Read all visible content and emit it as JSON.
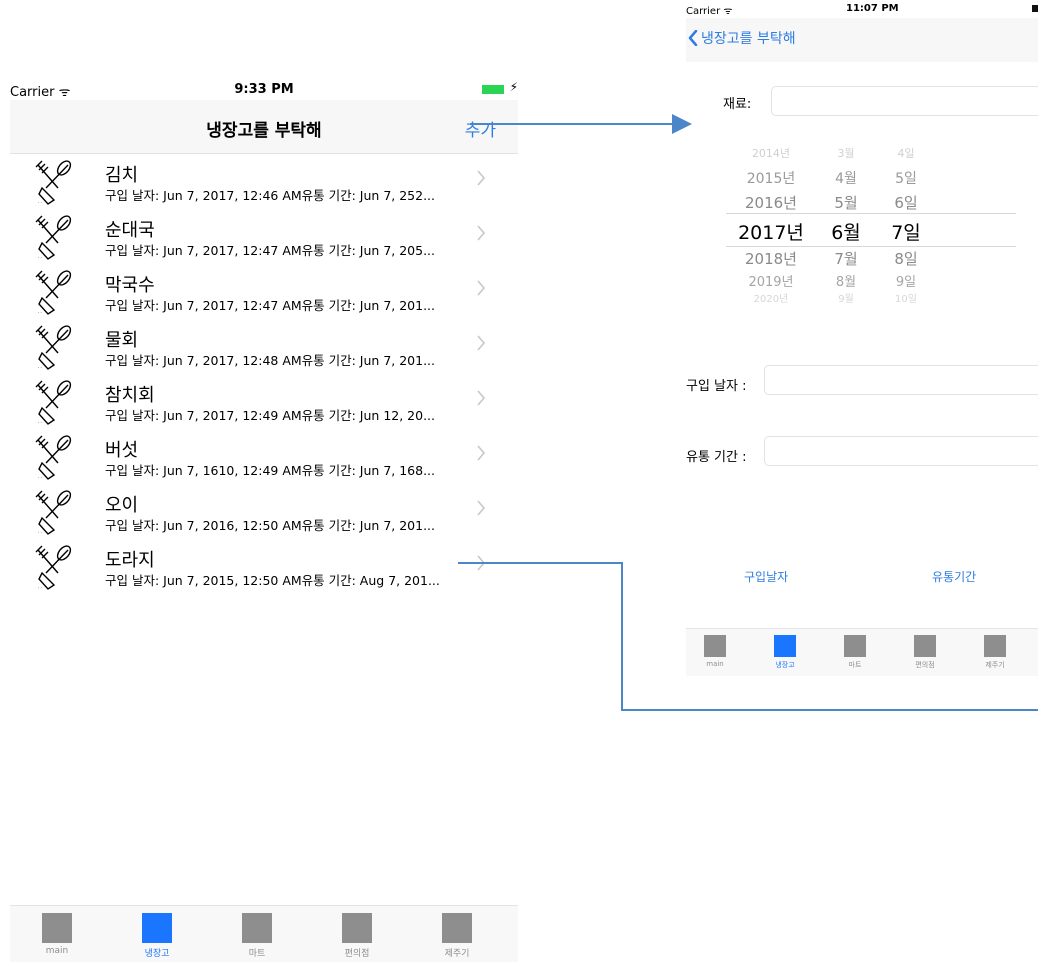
{
  "left_screen": {
    "status": {
      "carrier": "Carrier ᯤ",
      "time": "9:33 PM",
      "charge": "⚡"
    },
    "nav": {
      "title": "냉장고를 부탁해",
      "add_button": "추가"
    },
    "items": [
      {
        "name": "김치",
        "detail": "구입 날자: Jun 7, 2017, 12:46 AM유통 기간: Jun 7, 252..."
      },
      {
        "name": "순대국",
        "detail": "구입 날자: Jun 7, 2017, 12:47 AM유통 기간: Jun 7, 205..."
      },
      {
        "name": "막국수",
        "detail": "구입 날자: Jun 7, 2017, 12:47 AM유통 기간: Jun 7, 201..."
      },
      {
        "name": "물회",
        "detail": "구입 날자: Jun 7, 2017, 12:48 AM유통 기간: Jun 7, 201..."
      },
      {
        "name": "참치회",
        "detail": "구입 날자: Jun 7, 2017, 12:49 AM유통 기간: Jun 12, 20..."
      },
      {
        "name": "버섯",
        "detail": "구입 날자: Jun 7, 1610, 12:49 AM유통 기간: Jun 7, 168..."
      },
      {
        "name": "오이",
        "detail": "구입 날자: Jun 7, 2016, 12:50 AM유통 기간: Jun 7, 201..."
      },
      {
        "name": "도라지",
        "detail": "구입 날자: Jun 7, 2015, 12:50 AM유통 기간: Aug 7, 201..."
      }
    ],
    "tabs": [
      "main",
      "냉장고",
      "마트",
      "편의점",
      "제주기"
    ],
    "active_tab": 1
  },
  "right_screen": {
    "status": {
      "carrier": "Carrier ᯤ",
      "time": "11:07 PM"
    },
    "nav": {
      "back_label": "냉장고를 부탁해"
    },
    "ingredient_label": "재료:",
    "picker": {
      "years": [
        "2014년",
        "2015년",
        "2016년",
        "2017년",
        "2018년",
        "2019년",
        "2020년"
      ],
      "months": [
        "3월",
        "4월",
        "5월",
        "6월",
        "7월",
        "8월",
        "9월"
      ],
      "days": [
        "4일",
        "5일",
        "6일",
        "7일",
        "8일",
        "9일",
        "10일"
      ],
      "selected_index": 3
    },
    "purchase_date_label": "구입 날자 :",
    "expiry_label": "유통 기간 :",
    "purchase_button": "구입날자",
    "expiry_button": "유통기간",
    "tabs": [
      "main",
      "냉장고",
      "마트",
      "편의점",
      "제주기"
    ],
    "active_tab": 1
  },
  "colors": {
    "accent": "#2f7de1",
    "tab_active": "#1a76ff",
    "tab_inactive": "#8e8e8e",
    "battery": "#2bd454",
    "arrow": "#4a86c8"
  }
}
